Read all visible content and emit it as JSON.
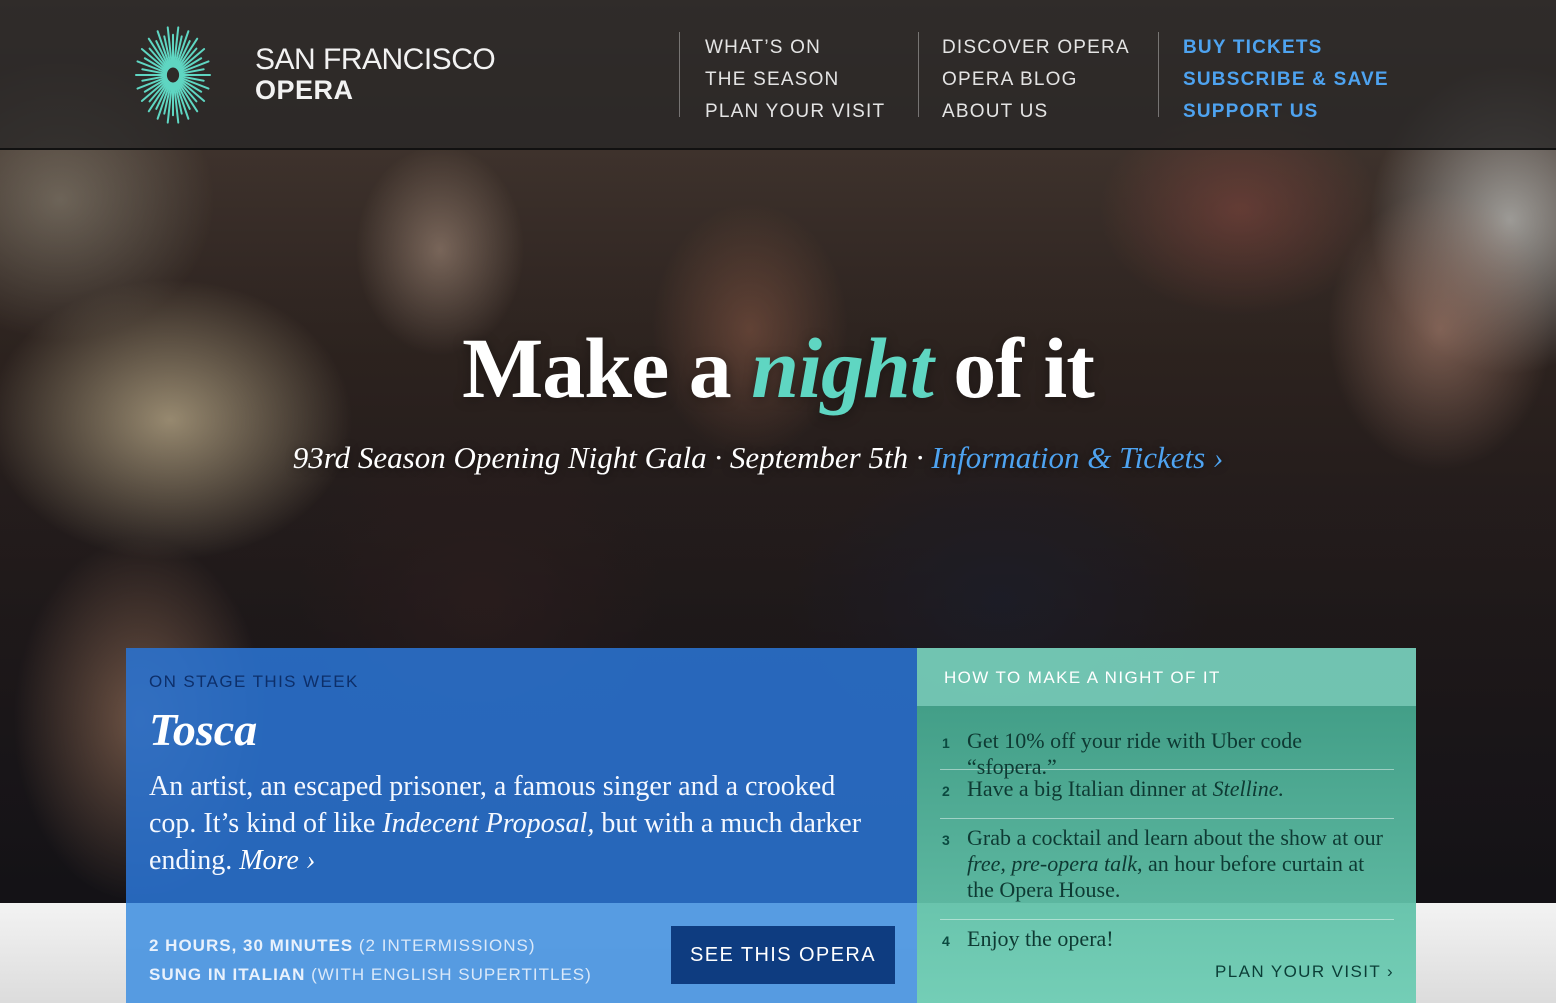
{
  "brand": {
    "line1": "SAN FRANCISCO",
    "line2": "OPERA",
    "accent_color": "#5fd6c2"
  },
  "nav": {
    "col1": [
      "WHAT’S ON",
      "THE SEASON",
      "PLAN YOUR VISIT"
    ],
    "col2": [
      "DISCOVER OPERA",
      "OPERA BLOG",
      "ABOUT US"
    ],
    "col3": [
      "BUY TICKETS",
      "SUBSCRIBE & SAVE",
      "SUPPORT US"
    ],
    "accent_color": "#4ea3f0"
  },
  "hero": {
    "title_pre": "Make a ",
    "title_highlight": "night",
    "title_post": " of it",
    "subtitle": "93rd Season Opening Night Gala · September 5th · ",
    "link": "Information & Tickets ›"
  },
  "feature": {
    "eyebrow": "ON STAGE THIS WEEK",
    "title": "Tosca",
    "desc_pre": "An artist, an escaped prisoner, a famous singer and a crooked cop. It’s kind of like ",
    "desc_em": "Indecent Proposal,",
    "desc_post": " but with a much darker ending. ",
    "more_link": "More ›",
    "duration": "2 HOURS, 30 MINUTES",
    "duration_note": "(2 INTERMISSIONS)",
    "language": "SUNG IN ITALIAN",
    "language_note": "(WITH ENGLISH SUPERTITLES)",
    "button": "SEE THIS OPERA",
    "button_color": "#0e3c80"
  },
  "howto": {
    "heading": "HOW TO MAKE A NIGHT OF IT",
    "tips": [
      {
        "num": "1",
        "text": "Get 10% off your ride with Uber code “sfopera.”"
      },
      {
        "num": "2",
        "pre": "Have a big Italian dinner at ",
        "em": "Stelline."
      },
      {
        "num": "3",
        "pre": "Grab a cocktail and learn about the show at our ",
        "em": "free, pre-opera talk",
        "post": ", an hour before curtain at the Opera House."
      },
      {
        "num": "4",
        "text": "Enjoy the opera!"
      }
    ],
    "link": "PLAN YOUR VISIT ›"
  }
}
